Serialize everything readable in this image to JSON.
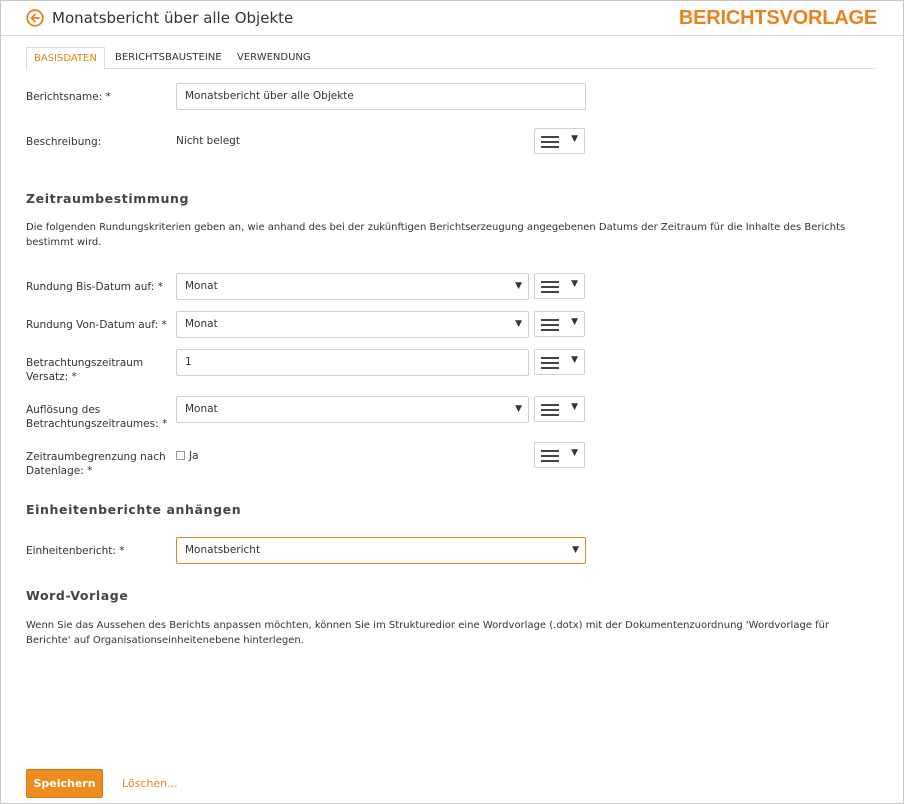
{
  "header": {
    "title": "Monatsbericht über alle Objekte",
    "brand": "BERICHTSVORLAGE"
  },
  "tabs": [
    {
      "label": "BASISDATEN",
      "active": true
    },
    {
      "label": "BERICHTSBAUSTEINE",
      "active": false
    },
    {
      "label": "VERWENDUNG",
      "active": false
    }
  ],
  "form": {
    "berichtsname": {
      "label": "Berichtsname: *",
      "value": "Monatsbericht über alle Objekte"
    },
    "beschreibung": {
      "label": "Beschreibung:",
      "value": "Nicht belegt"
    }
  },
  "zeitraum": {
    "heading": "Zeitraumbestimmung",
    "description": "Die folgenden Rundungskriterien geben an, wie anhand des bei der zukünftigen Berichtserzeugung angegebenen Datums der Zeitraum für die Inhalte des Berichts bestimmt wird.",
    "bis": {
      "label": "Rundung Bis-Datum auf: *",
      "value": "Monat"
    },
    "von": {
      "label": "Rundung Von-Datum auf: *",
      "value": "Monat"
    },
    "versatz": {
      "label": "Betrachtungszeitraum Versatz: *",
      "value": "1"
    },
    "aufloesung": {
      "label": "Auflösung des Betrachtungszeitraumes: *",
      "value": "Monat"
    },
    "begrenzung": {
      "label": "Zeitraumbegrenzung nach Datenlage: *",
      "checkbox_label": "Ja",
      "checked": false
    }
  },
  "einheiten": {
    "heading": "Einheitenberichte anhängen",
    "label": "Einheitenbericht: *",
    "value": "Monatsbericht"
  },
  "word": {
    "heading": "Word-Vorlage",
    "description": "Wenn Sie das Aussehen des Berichts anpassen möchten, können Sie im Strukturedior eine Wordvorlage (.dotx) mit der Dokumentenzuordnung 'Wordvorlage für Berichte' auf Organisationseinheitenebene hinterlegen."
  },
  "actions": {
    "save_label": "Speichern",
    "delete_label": "Löschen..."
  },
  "icons": {
    "back": "back-arrow-circle-icon",
    "menu": "hamburger-menu-icon",
    "caret": "caret-down-icon"
  },
  "colors": {
    "accent": "#e8821e",
    "save_button": "#ef8c1e"
  }
}
